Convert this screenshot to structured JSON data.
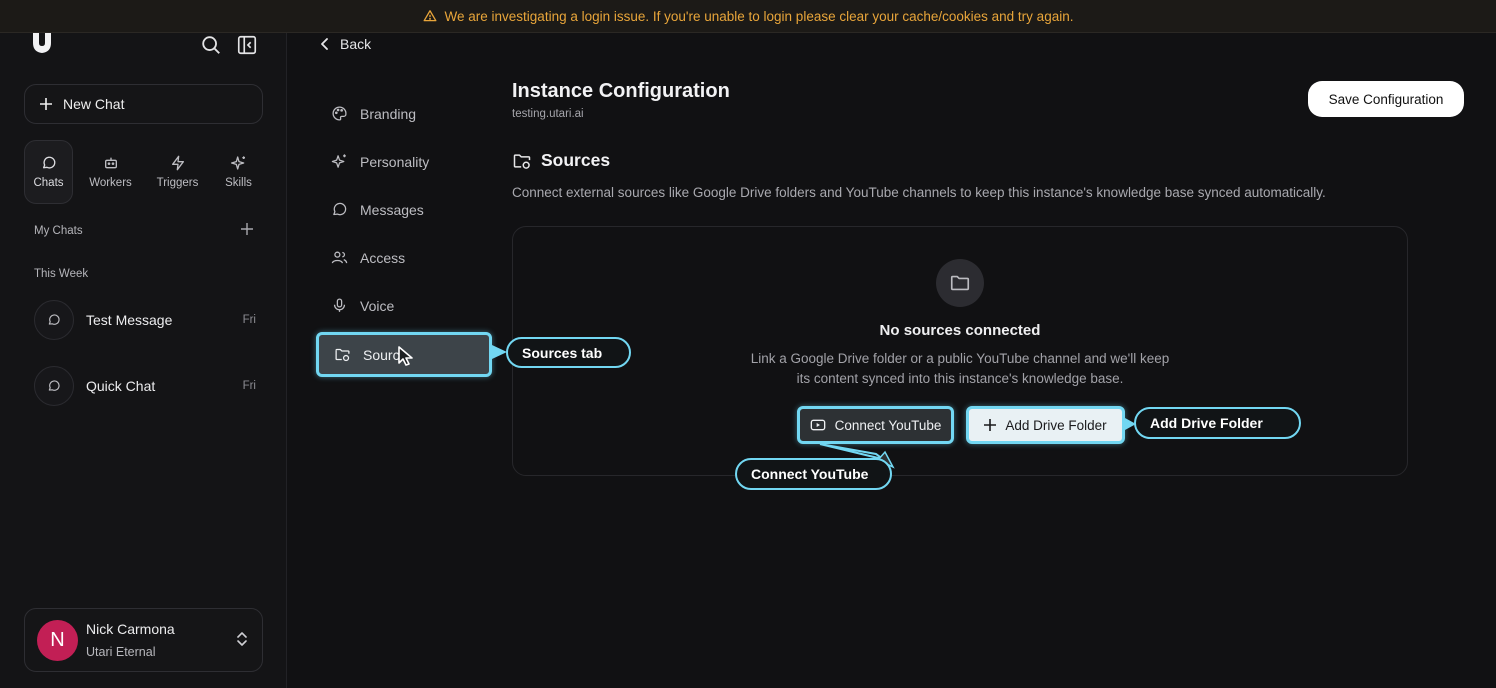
{
  "banner": {
    "icon": "warning-icon",
    "text": "We are investigating a login issue. If you're unable to login please clear your cache/cookies and try again.",
    "color": "#e8a53a"
  },
  "sidebar": {
    "new_chat_label": "New Chat",
    "nav": [
      {
        "label": "Chats",
        "icon": "chat-bubble-icon",
        "active": true
      },
      {
        "label": "Workers",
        "icon": "robot-icon"
      },
      {
        "label": "Triggers",
        "icon": "lightning-icon"
      },
      {
        "label": "Skills",
        "icon": "sparkles-icon"
      }
    ],
    "my_chats_label": "My Chats",
    "this_week_label": "This Week",
    "chats": [
      {
        "title": "Test Message",
        "date": "Fri"
      },
      {
        "title": "Quick Chat",
        "date": "Fri"
      }
    ],
    "user": {
      "initial": "N",
      "name": "Nick Carmona",
      "org": "Utari Eternal",
      "avatar_color": "#c21f55"
    }
  },
  "settings": {
    "back_label": "Back",
    "menu": [
      {
        "label": "Branding",
        "icon": "palette-icon"
      },
      {
        "label": "Personality",
        "icon": "sparkles-icon"
      },
      {
        "label": "Messages",
        "icon": "message-icon"
      },
      {
        "label": "Access",
        "icon": "users-icon"
      },
      {
        "label": "Voice",
        "icon": "microphone-icon"
      },
      {
        "label": "Sourc",
        "icon": "folder-sync-icon",
        "active": true
      }
    ]
  },
  "main": {
    "title": "Instance Configuration",
    "subtitle": "testing.utari.ai",
    "save_label": "Save Configuration",
    "section_title": "Sources",
    "section_desc": "Connect external sources like Google Drive folders and YouTube channels to keep this instance's knowledge base synced automatically.",
    "empty_title": "No sources connected",
    "empty_desc_line1": "Link a Google Drive folder or a public YouTube channel and we'll keep",
    "empty_desc_line2": "its content synced into this instance's knowledge base.",
    "connect_youtube_label": "Connect YouTube",
    "add_drive_label": "Add Drive Folder"
  },
  "annotations": {
    "sources_tab": "Sources tab",
    "connect_youtube": "Connect YouTube",
    "add_drive_folder": "Add Drive Folder",
    "highlight_color": "#72d7f2"
  }
}
